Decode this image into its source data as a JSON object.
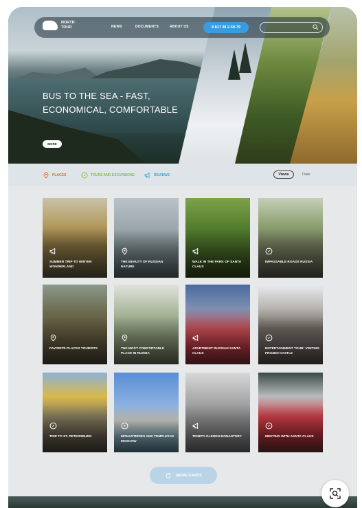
{
  "header": {
    "logo_text": "NORTH TOUR",
    "nav": [
      "NEWS",
      "DOCUMENTS",
      "ABOUT US"
    ],
    "phone": "8 817 38 2-59-79",
    "search_placeholder": ""
  },
  "hero": {
    "title": "BUS TO THE SEA - FAST, ECONOMICAL, COMFORTABLE",
    "more_label": "MORE"
  },
  "filters": {
    "items": [
      {
        "label": "PLACES",
        "icon": "map-pin-icon",
        "color": "#e8643c"
      },
      {
        "label": "TOURS AND EXCURSIONS",
        "icon": "compass-icon",
        "color": "#7cc24a"
      },
      {
        "label": "REVIEWS",
        "icon": "megaphone-icon",
        "color": "#3aa6c8"
      }
    ],
    "sort_views": "Views",
    "sort_date": "Date"
  },
  "cards": [
    {
      "title": "SUMMER TRIP TO WINTER WONDERLAND",
      "icon": "megaphone-icon"
    },
    {
      "title": "THE BEAUTY OF RUSSIAN NATURE",
      "icon": "map-pin-icon"
    },
    {
      "title": "WALK IN THE PARK OF SANTA CLAUS",
      "icon": "megaphone-icon"
    },
    {
      "title": "IMPASSABLE ROADS RUSSIA",
      "icon": "compass-icon"
    },
    {
      "title": "FAVORITE PLACES TOURISTS",
      "icon": "map-pin-icon"
    },
    {
      "title": "THE MOST COMFORTABLE PLACE IN RUSSIA",
      "icon": "map-pin-icon"
    },
    {
      "title": "APARTMENT RUSSIAN SANTA CLAUS",
      "icon": "megaphone-icon"
    },
    {
      "title": "ENTERTAINMENT TOUR: VISITING FROZEN CASTLE",
      "icon": "compass-icon"
    },
    {
      "title": "TRIP TO ST. PETERSBURG",
      "icon": "compass-icon"
    },
    {
      "title": "MONASTERIES AND TEMPLES IN MOSCOW",
      "icon": "compass-icon"
    },
    {
      "title": "TRINITY-GLEDEN MONASTERY",
      "icon": "megaphone-icon"
    },
    {
      "title": "MEETING WITH SANTA CLAUS",
      "icon": "compass-icon"
    }
  ],
  "more_cards_label": "MORE CARDS",
  "colors": {
    "accent": "#3a9ce0",
    "more_cards_bg": "#b8d4e6"
  }
}
